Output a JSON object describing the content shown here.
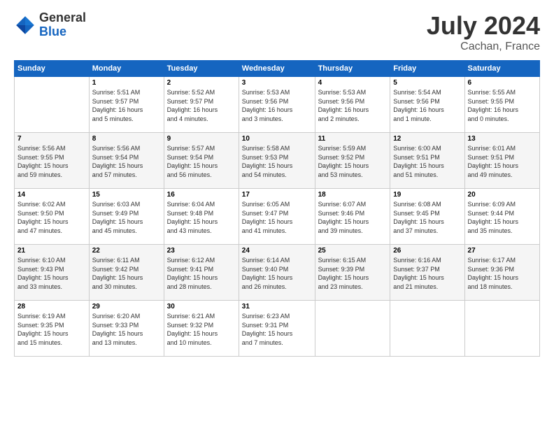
{
  "header": {
    "logo_general": "General",
    "logo_blue": "Blue",
    "month_year": "July 2024",
    "location": "Cachan, France"
  },
  "weekdays": [
    "Sunday",
    "Monday",
    "Tuesday",
    "Wednesday",
    "Thursday",
    "Friday",
    "Saturday"
  ],
  "weeks": [
    [
      {
        "day": "",
        "info": ""
      },
      {
        "day": "1",
        "info": "Sunrise: 5:51 AM\nSunset: 9:57 PM\nDaylight: 16 hours\nand 5 minutes."
      },
      {
        "day": "2",
        "info": "Sunrise: 5:52 AM\nSunset: 9:57 PM\nDaylight: 16 hours\nand 4 minutes."
      },
      {
        "day": "3",
        "info": "Sunrise: 5:53 AM\nSunset: 9:56 PM\nDaylight: 16 hours\nand 3 minutes."
      },
      {
        "day": "4",
        "info": "Sunrise: 5:53 AM\nSunset: 9:56 PM\nDaylight: 16 hours\nand 2 minutes."
      },
      {
        "day": "5",
        "info": "Sunrise: 5:54 AM\nSunset: 9:56 PM\nDaylight: 16 hours\nand 1 minute."
      },
      {
        "day": "6",
        "info": "Sunrise: 5:55 AM\nSunset: 9:55 PM\nDaylight: 16 hours\nand 0 minutes."
      }
    ],
    [
      {
        "day": "7",
        "info": "Sunrise: 5:56 AM\nSunset: 9:55 PM\nDaylight: 15 hours\nand 59 minutes."
      },
      {
        "day": "8",
        "info": "Sunrise: 5:56 AM\nSunset: 9:54 PM\nDaylight: 15 hours\nand 57 minutes."
      },
      {
        "day": "9",
        "info": "Sunrise: 5:57 AM\nSunset: 9:54 PM\nDaylight: 15 hours\nand 56 minutes."
      },
      {
        "day": "10",
        "info": "Sunrise: 5:58 AM\nSunset: 9:53 PM\nDaylight: 15 hours\nand 54 minutes."
      },
      {
        "day": "11",
        "info": "Sunrise: 5:59 AM\nSunset: 9:52 PM\nDaylight: 15 hours\nand 53 minutes."
      },
      {
        "day": "12",
        "info": "Sunrise: 6:00 AM\nSunset: 9:51 PM\nDaylight: 15 hours\nand 51 minutes."
      },
      {
        "day": "13",
        "info": "Sunrise: 6:01 AM\nSunset: 9:51 PM\nDaylight: 15 hours\nand 49 minutes."
      }
    ],
    [
      {
        "day": "14",
        "info": "Sunrise: 6:02 AM\nSunset: 9:50 PM\nDaylight: 15 hours\nand 47 minutes."
      },
      {
        "day": "15",
        "info": "Sunrise: 6:03 AM\nSunset: 9:49 PM\nDaylight: 15 hours\nand 45 minutes."
      },
      {
        "day": "16",
        "info": "Sunrise: 6:04 AM\nSunset: 9:48 PM\nDaylight: 15 hours\nand 43 minutes."
      },
      {
        "day": "17",
        "info": "Sunrise: 6:05 AM\nSunset: 9:47 PM\nDaylight: 15 hours\nand 41 minutes."
      },
      {
        "day": "18",
        "info": "Sunrise: 6:07 AM\nSunset: 9:46 PM\nDaylight: 15 hours\nand 39 minutes."
      },
      {
        "day": "19",
        "info": "Sunrise: 6:08 AM\nSunset: 9:45 PM\nDaylight: 15 hours\nand 37 minutes."
      },
      {
        "day": "20",
        "info": "Sunrise: 6:09 AM\nSunset: 9:44 PM\nDaylight: 15 hours\nand 35 minutes."
      }
    ],
    [
      {
        "day": "21",
        "info": "Sunrise: 6:10 AM\nSunset: 9:43 PM\nDaylight: 15 hours\nand 33 minutes."
      },
      {
        "day": "22",
        "info": "Sunrise: 6:11 AM\nSunset: 9:42 PM\nDaylight: 15 hours\nand 30 minutes."
      },
      {
        "day": "23",
        "info": "Sunrise: 6:12 AM\nSunset: 9:41 PM\nDaylight: 15 hours\nand 28 minutes."
      },
      {
        "day": "24",
        "info": "Sunrise: 6:14 AM\nSunset: 9:40 PM\nDaylight: 15 hours\nand 26 minutes."
      },
      {
        "day": "25",
        "info": "Sunrise: 6:15 AM\nSunset: 9:39 PM\nDaylight: 15 hours\nand 23 minutes."
      },
      {
        "day": "26",
        "info": "Sunrise: 6:16 AM\nSunset: 9:37 PM\nDaylight: 15 hours\nand 21 minutes."
      },
      {
        "day": "27",
        "info": "Sunrise: 6:17 AM\nSunset: 9:36 PM\nDaylight: 15 hours\nand 18 minutes."
      }
    ],
    [
      {
        "day": "28",
        "info": "Sunrise: 6:19 AM\nSunset: 9:35 PM\nDaylight: 15 hours\nand 15 minutes."
      },
      {
        "day": "29",
        "info": "Sunrise: 6:20 AM\nSunset: 9:33 PM\nDaylight: 15 hours\nand 13 minutes."
      },
      {
        "day": "30",
        "info": "Sunrise: 6:21 AM\nSunset: 9:32 PM\nDaylight: 15 hours\nand 10 minutes."
      },
      {
        "day": "31",
        "info": "Sunrise: 6:23 AM\nSunset: 9:31 PM\nDaylight: 15 hours\nand 7 minutes."
      },
      {
        "day": "",
        "info": ""
      },
      {
        "day": "",
        "info": ""
      },
      {
        "day": "",
        "info": ""
      }
    ]
  ]
}
